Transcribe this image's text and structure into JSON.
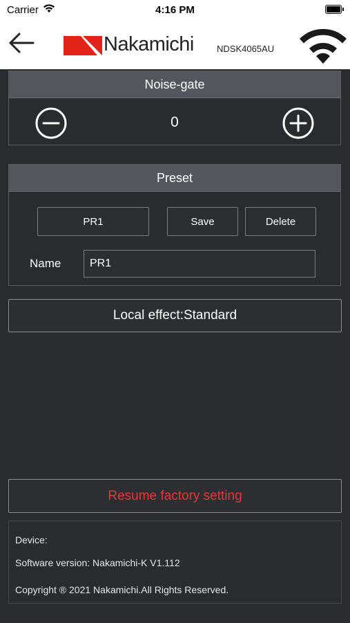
{
  "status_bar": {
    "carrier": "Carrier",
    "time": "4:16 PM",
    "icons": [
      "wifi-icon",
      "battery-icon"
    ]
  },
  "header": {
    "back_icon": "back-arrow-icon",
    "brand": "Nakamichi",
    "device_id": "NDSK4065AU",
    "connection_icon": "wifi-icon",
    "brand_color": "#e2231a"
  },
  "noise_gate": {
    "title": "Noise-gate",
    "value": "0",
    "decrease_icon": "minus-circle-icon",
    "increase_icon": "plus-circle-icon"
  },
  "preset": {
    "title": "Preset",
    "selected": "PR1",
    "save_label": "Save",
    "delete_label": "Delete",
    "name_label": "Name",
    "name_value": "PR1"
  },
  "local_effect": {
    "label": "Local effect:Standard"
  },
  "resume": {
    "label": "Resume factory setting",
    "color": "#e5363a"
  },
  "info": {
    "device": "Device:",
    "software": "Software version: Nakamichi-K V1.112",
    "copyright": "Copyright ® 2021 Nakamichi.All Rights Reserved."
  }
}
